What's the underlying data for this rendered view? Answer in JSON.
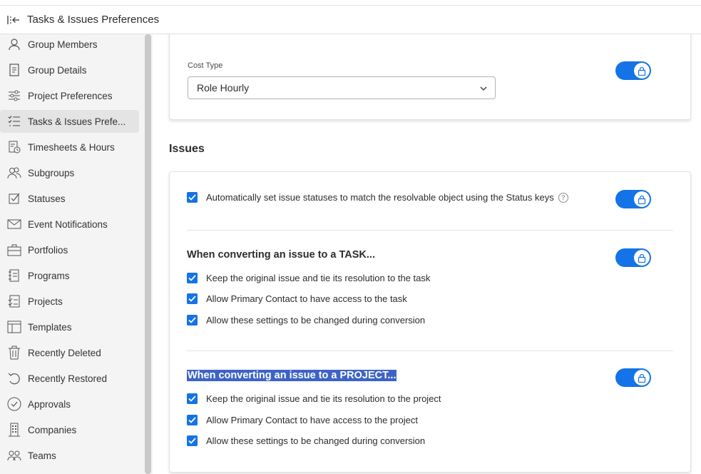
{
  "header": {
    "title": "Tasks & Issues Preferences",
    "back_icon": "collapse-left-icon"
  },
  "sidebar": {
    "items": [
      {
        "label": "Group Members",
        "icon": "user-icon",
        "active": false
      },
      {
        "label": "Group Details",
        "icon": "document-icon",
        "active": false
      },
      {
        "label": "Project Preferences",
        "icon": "sliders-icon",
        "active": false
      },
      {
        "label": "Tasks & Issues Prefe...",
        "icon": "checklist-icon",
        "active": true
      },
      {
        "label": "Timesheets & Hours",
        "icon": "timesheet-icon",
        "active": false
      },
      {
        "label": "Subgroups",
        "icon": "users-icon",
        "active": false
      },
      {
        "label": "Statuses",
        "icon": "status-icon",
        "active": false
      },
      {
        "label": "Event Notifications",
        "icon": "mail-icon",
        "active": false
      },
      {
        "label": "Portfolios",
        "icon": "briefcase-icon",
        "active": false
      },
      {
        "label": "Programs",
        "icon": "program-icon",
        "active": false
      },
      {
        "label": "Projects",
        "icon": "project-icon",
        "active": false
      },
      {
        "label": "Templates",
        "icon": "template-icon",
        "active": false
      },
      {
        "label": "Recently Deleted",
        "icon": "trash-icon",
        "active": false
      },
      {
        "label": "Recently Restored",
        "icon": "restore-icon",
        "active": false
      },
      {
        "label": "Approvals",
        "icon": "approval-icon",
        "active": false
      },
      {
        "label": "Companies",
        "icon": "building-icon",
        "active": false
      },
      {
        "label": "Teams",
        "icon": "team-icon",
        "active": false
      }
    ]
  },
  "cost": {
    "label": "Cost Type",
    "value": "Role Hourly"
  },
  "issues": {
    "title": "Issues",
    "auto_status": {
      "label": "Automatically set issue statuses to match the resolvable object using the Status keys",
      "checked": true
    },
    "task": {
      "heading": "When converting an issue to a TASK...",
      "options": [
        {
          "label": "Keep the original issue and tie its resolution to the task",
          "checked": true
        },
        {
          "label": "Allow Primary Contact to have access to the task",
          "checked": true
        },
        {
          "label": "Allow these settings to be changed during conversion",
          "checked": true
        }
      ]
    },
    "project": {
      "heading": "When converting an issue to a PROJECT...",
      "options": [
        {
          "label": "Keep the original issue and tie its resolution to the project",
          "checked": true
        },
        {
          "label": "Allow Primary Contact to have access to the project",
          "checked": true
        },
        {
          "label": "Allow these settings to be changed during conversion",
          "checked": true
        }
      ]
    }
  },
  "help_glyph": "?",
  "colors": {
    "accent": "#1473e6",
    "selection": "#3d63c6",
    "sidebar_bg": "#f4f4f4"
  }
}
